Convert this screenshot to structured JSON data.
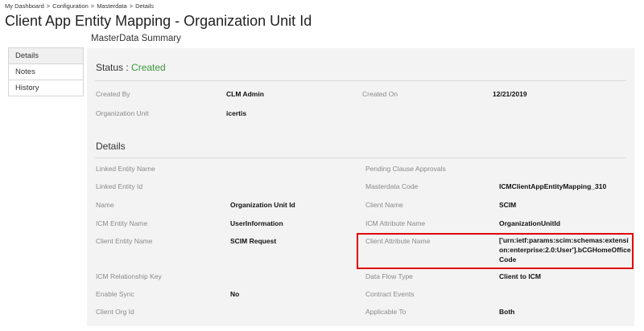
{
  "breadcrumb": [
    "My Dashboard",
    "Configuration",
    "Masterdata",
    "Details"
  ],
  "breadcrumb_sep": ">",
  "page_title": "Client App Entity Mapping - Organization Unit Id",
  "subtitle": "MasterData Summary",
  "side_nav": [
    {
      "label": "Details"
    },
    {
      "label": "Notes"
    },
    {
      "label": "History"
    }
  ],
  "status": {
    "label": "Status :",
    "value": "Created",
    "color": "#3b9a3b"
  },
  "summary": {
    "created_by_label": "Created By",
    "created_by_value": "CLM Admin",
    "created_on_label": "Created On",
    "created_on_value": "12/21/2019",
    "org_unit_label": "Organization Unit",
    "org_unit_value": "icertis"
  },
  "details": {
    "title": "Details",
    "left": [
      {
        "label": "Linked Entity Name",
        "value": ""
      },
      {
        "label": "Linked Entity Id",
        "value": ""
      },
      {
        "label": "Name",
        "value": "Organization Unit Id"
      },
      {
        "label": "ICM Entity Name",
        "value": "UserInformation"
      },
      {
        "label": "Client Entity Name",
        "value": "SCIM Request"
      },
      {
        "label": "ICM Relationship Key",
        "value": ""
      },
      {
        "label": "Enable Sync",
        "value": "No"
      },
      {
        "label": "Client Org Id",
        "value": ""
      }
    ],
    "right": [
      {
        "label": "Pending Clause Approvals",
        "value": ""
      },
      {
        "label": "Masterdata Code",
        "value": "ICMClientAppEntityMapping_310"
      },
      {
        "label": "Client Name",
        "value": "SCIM"
      },
      {
        "label": "ICM Attribute Name",
        "value": "OrganizationUnitId"
      },
      {
        "label": "Client Attribute Name",
        "value": "['urn:ietf:params:scim:schemas:extension:enterprise:2.0:User'].bCGHomeOfficeCode"
      },
      {
        "label": "Data Flow Type",
        "value": "Client to ICM"
      },
      {
        "label": "Contract Events",
        "value": ""
      },
      {
        "label": "Applicable To",
        "value": "Both"
      }
    ]
  },
  "highlight_color": "#e00000"
}
